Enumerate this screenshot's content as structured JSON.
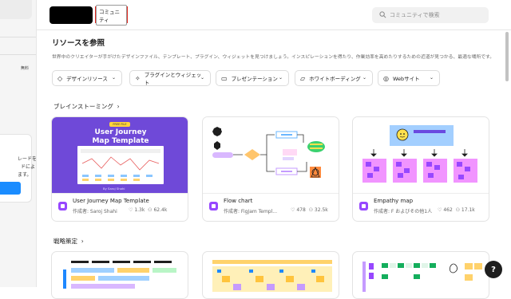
{
  "sidebar": {
    "badge": "無料",
    "promo_line1": "レードを",
    "promo_line2": "ドによ",
    "promo_line3": "ます。"
  },
  "header": {
    "community_label": "コミュニティ",
    "search_placeholder": "コミュニティで検索"
  },
  "page": {
    "title": "リソースを参照",
    "description": "世界中のクリエイターが手がけたデザインファイル、テンプレート、プラグイン、ウィジェットを見つけましょう。インスピレーションを得たり、作業効率を高めたりするための近道が見つかる、最適な場所です。"
  },
  "filters": [
    {
      "label": "デザインリソース",
      "icon": "design-icon"
    },
    {
      "label": "プラグインとウィジェット",
      "icon": "plugin-icon"
    },
    {
      "label": "プレゼンテーション",
      "icon": "presentation-icon"
    },
    {
      "label": "ホワイトボーディング",
      "icon": "whiteboard-icon"
    },
    {
      "label": "Webサイト",
      "icon": "globe-icon"
    }
  ],
  "sections": {
    "brainstorm": "ブレインストーミング",
    "strategy": "戦略策定"
  },
  "cards": [
    {
      "name": "User Journey Map Template",
      "author": "作成者: Saroj Shahi",
      "likes": "1.3k",
      "users": "62.4k",
      "thumb_badge": "FREE FILE",
      "thumb_title1": "User Journey",
      "thumb_title2": "Map Template",
      "thumb_by": "By Saroj Shahi"
    },
    {
      "name": "Flow chart",
      "author": "作成者: FigJam Templ...",
      "likes": "478",
      "users": "32.5k"
    },
    {
      "name": "Empathy map",
      "author": "作成者: F およびその他1人",
      "likes": "462",
      "users": "17.1k"
    }
  ],
  "help": "?",
  "colors": {
    "accent_purple": "#9747ff",
    "highlight_red": "#e0261e"
  }
}
